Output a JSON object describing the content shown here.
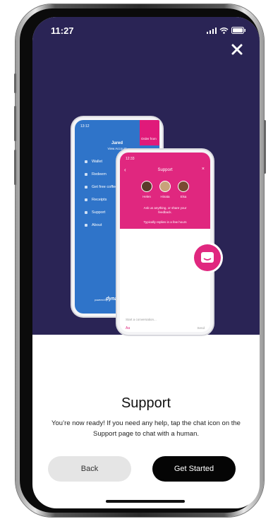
{
  "status_bar": {
    "time": "11:27"
  },
  "illustration": {
    "back_phone": {
      "time": "13:12",
      "user_name": "Jared",
      "view_account": "View Account",
      "order_from": "Order from",
      "menu": [
        "Wallet",
        "Redeem",
        "Get free coffee",
        "Receipts",
        "Support",
        "About"
      ],
      "powered_by": "powered by",
      "brand": "dyna"
    },
    "front_phone": {
      "time": "12:33",
      "header": "Support",
      "agents": [
        "Helen",
        "Hinata",
        "Elsa"
      ],
      "prompt": "Ask us anything, or share your feedback.",
      "reply_time": "Typically replies in a few hours",
      "input_placeholder": "Start a conversation...",
      "send_label": "Send",
      "format_label": "Aa"
    }
  },
  "content": {
    "title": "Support",
    "description": "You’re now ready! If you need any help, tap the chat icon on the Support page to chat with a human."
  },
  "buttons": {
    "back_label": "Back",
    "start_label": "Get Started"
  },
  "colors": {
    "hero": "#2a2455",
    "pink": "#e0277f",
    "blue": "#2f74c9"
  }
}
